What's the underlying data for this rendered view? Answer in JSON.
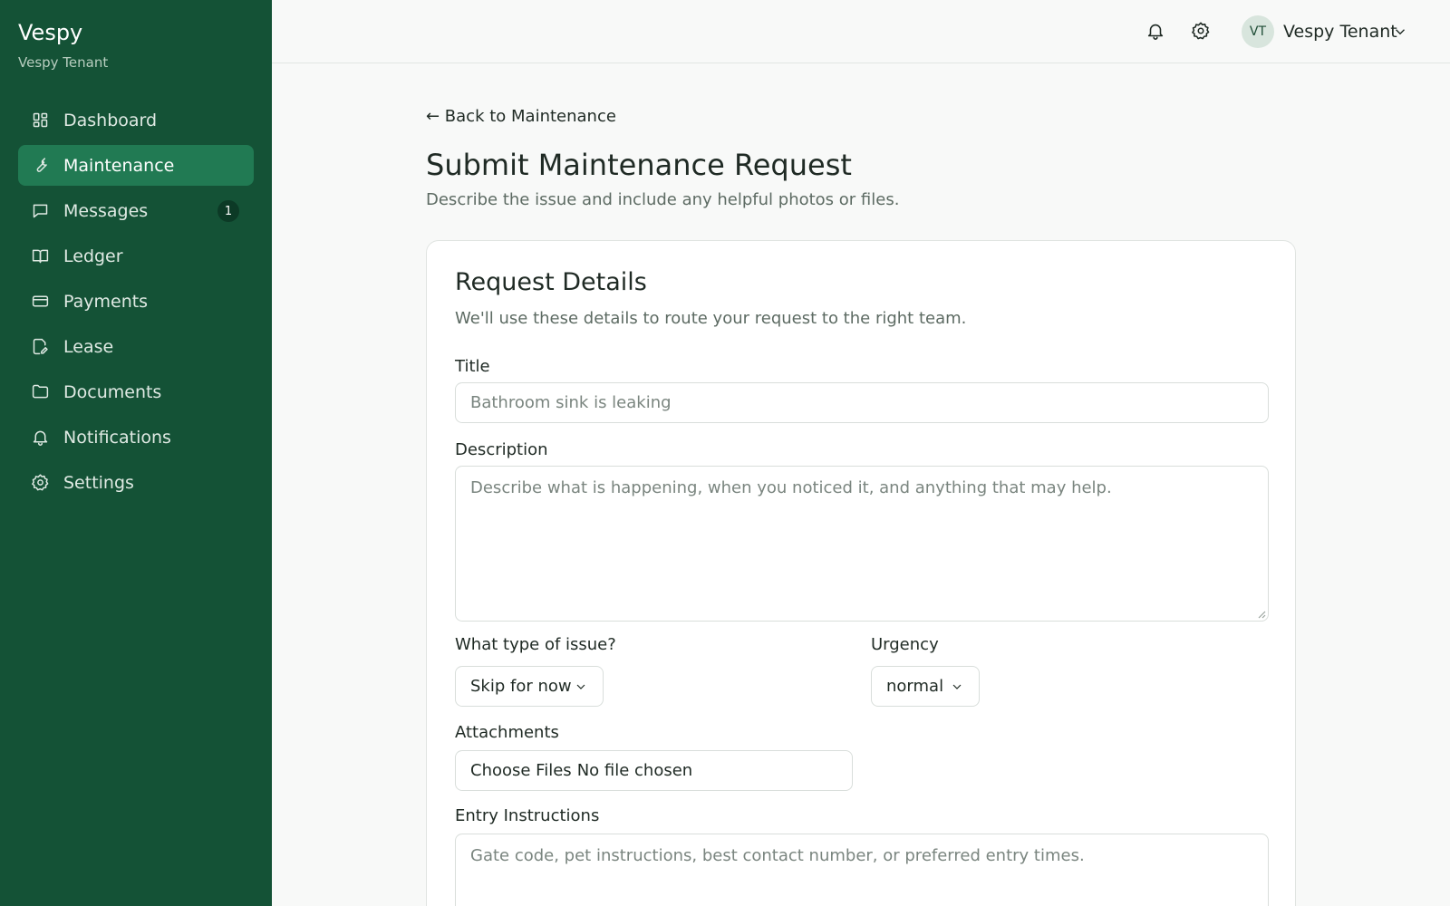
{
  "brand": {
    "name": "Vespy",
    "subtitle": "Vespy Tenant"
  },
  "sidebar": {
    "items": [
      {
        "label": "Dashboard",
        "icon": "dashboard-icon"
      },
      {
        "label": "Maintenance",
        "icon": "wrench-icon",
        "active": true
      },
      {
        "label": "Messages",
        "icon": "message-icon",
        "badge": "1"
      },
      {
        "label": "Ledger",
        "icon": "book-icon"
      },
      {
        "label": "Payments",
        "icon": "credit-card-icon"
      },
      {
        "label": "Lease",
        "icon": "document-edit-icon"
      },
      {
        "label": "Documents",
        "icon": "folder-icon"
      },
      {
        "label": "Notifications",
        "icon": "bell-icon"
      },
      {
        "label": "Settings",
        "icon": "gear-icon"
      }
    ]
  },
  "header": {
    "user_initials": "VT",
    "user_name": "Vespy Tenant"
  },
  "main": {
    "back_link": "← Back to Maintenance",
    "title": "Submit Maintenance Request",
    "subtitle": "Describe the issue and include any helpful photos or files."
  },
  "form": {
    "card_title": "Request Details",
    "card_subtitle": "We'll use these details to route your request to the right team.",
    "title_label": "Title",
    "title_placeholder": "Bathroom sink is leaking",
    "description_label": "Description",
    "description_placeholder": "Describe what is happening, when you noticed it, and anything that may help.",
    "issue_type_label": "What type of issue?",
    "issue_type_value": "Skip for now",
    "urgency_label": "Urgency",
    "urgency_value": "normal",
    "attachments_label": "Attachments",
    "choose_files_label": "Choose Files",
    "no_file_text": "No file chosen",
    "entry_label": "Entry Instructions",
    "entry_placeholder": "Gate code, pet instructions, best contact number, or preferred entry times."
  },
  "colors": {
    "sidebar_bg": "#145236",
    "sidebar_active": "#217a53",
    "page_bg": "#f8f9f8"
  }
}
